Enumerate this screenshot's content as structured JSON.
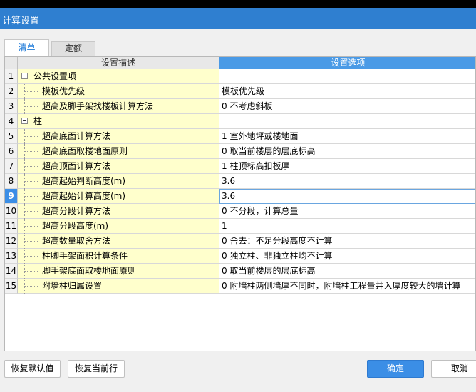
{
  "window": {
    "title": "计算设置"
  },
  "tabs": [
    {
      "label": "清单"
    },
    {
      "label": "定额"
    }
  ],
  "table": {
    "columns": {
      "description": "设置描述",
      "option": "设置选项"
    },
    "rows": [
      {
        "num": "1",
        "desc": "公共设置项",
        "value": "",
        "group": true
      },
      {
        "num": "2",
        "desc": "模板优先级",
        "value": "模板优先级"
      },
      {
        "num": "3",
        "desc": "超高及脚手架找楼板计算方法",
        "value": "0 不考虑斜板"
      },
      {
        "num": "4",
        "desc": "柱",
        "value": "",
        "group": true
      },
      {
        "num": "5",
        "desc": "超高底面计算方法",
        "value": "1 室外地坪或楼地面"
      },
      {
        "num": "6",
        "desc": "超高底面取楼地面原则",
        "value": "0 取当前楼层的层底标高"
      },
      {
        "num": "7",
        "desc": "超高顶面计算方法",
        "value": "1 柱顶标高扣板厚"
      },
      {
        "num": "8",
        "desc": "超高起始判断高度(m)",
        "value": "3.6"
      },
      {
        "num": "9",
        "desc": "超高起始计算高度(m)",
        "value": "3.6",
        "selected": true
      },
      {
        "num": "10",
        "desc": "超高分段计算方法",
        "value": "0 不分段，计算总量"
      },
      {
        "num": "11",
        "desc": "超高分段高度(m)",
        "value": "1"
      },
      {
        "num": "12",
        "desc": "超高数量取舍方法",
        "value": "0 舍去：不足分段高度不计算"
      },
      {
        "num": "13",
        "desc": "柱脚手架面积计算条件",
        "value": "0 独立柱、非独立柱均不计算"
      },
      {
        "num": "14",
        "desc": "脚手架底面取楼地面原则",
        "value": "0 取当前楼层的层底标高"
      },
      {
        "num": "15",
        "desc": "附墙柱归属设置",
        "value": "0 附墙柱两侧墙厚不同时，附墙柱工程量并入厚度较大的墙计算"
      }
    ]
  },
  "buttons": {
    "restore_default": "恢复默认值",
    "restore_row": "恢复当前行",
    "ok": "确定",
    "cancel": "取消"
  }
}
